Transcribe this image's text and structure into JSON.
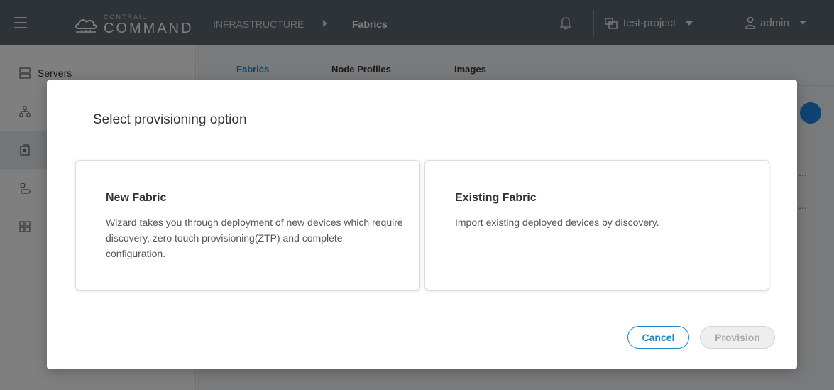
{
  "topbar": {
    "logo_small": "CONTRAIL",
    "logo_big": "COMMAND",
    "breadcrumb": [
      "INFRASTRUCTURE",
      "Fabrics"
    ],
    "project": "test-project",
    "user": "admin"
  },
  "sidebar": {
    "items": [
      {
        "label": "Servers",
        "icon": "server-icon"
      },
      {
        "label": "",
        "icon": "cluster-icon"
      },
      {
        "label": "",
        "icon": "fabric-icon",
        "active": true
      },
      {
        "label": "",
        "icon": "nodes-icon"
      },
      {
        "label": "",
        "icon": "image-icon"
      }
    ]
  },
  "tabs": [
    {
      "label": "Fabrics",
      "active": true
    },
    {
      "label": "Node Profiles",
      "active": false
    },
    {
      "label": "Images",
      "active": false
    }
  ],
  "modal": {
    "title": "Select provisioning option",
    "options": [
      {
        "title": "New Fabric",
        "description": "Wizard takes you through deployment of new devices which require discovery, zero touch provisioning(ZTP) and complete configuration."
      },
      {
        "title": "Existing Fabric",
        "description": "Import existing deployed devices by discovery."
      }
    ],
    "cancel_label": "Cancel",
    "provision_label": "Provision"
  },
  "colors": {
    "topbar": "#5c6770",
    "accent": "#1e88c8",
    "overlay": "rgba(0,0,0,0.5)"
  }
}
